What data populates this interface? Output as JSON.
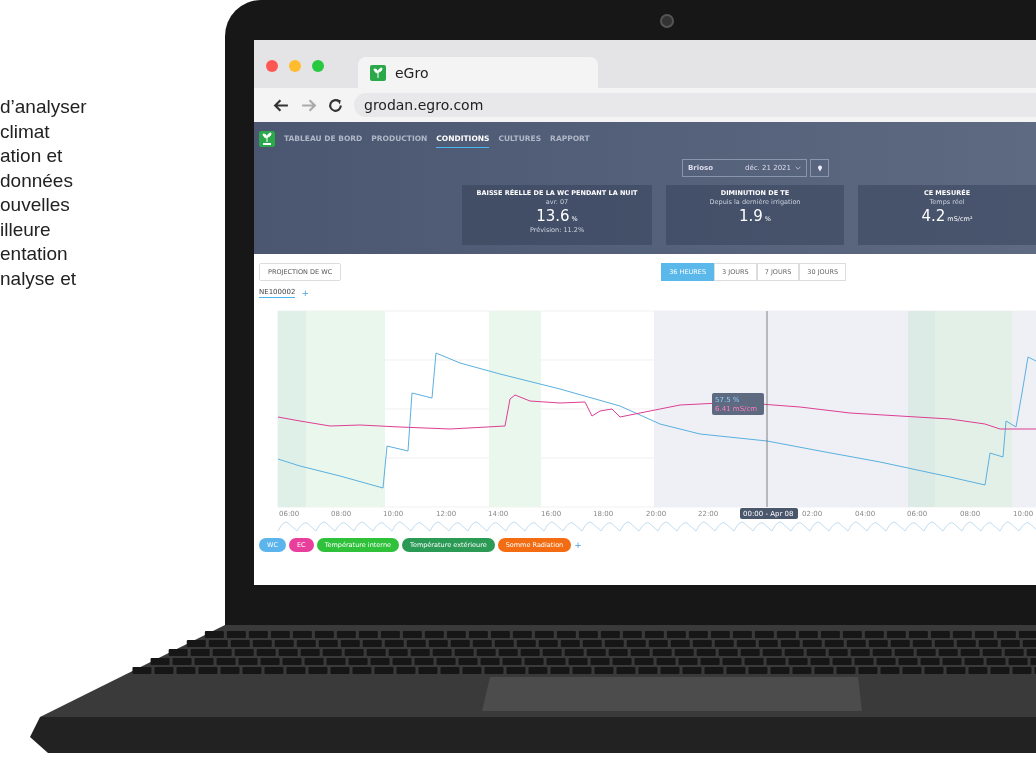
{
  "intro_lines": [
    "d’analyser",
    "climat",
    "ation et",
    "données",
    "ouvelles",
    "illeure",
    "entation",
    "nalyse et"
  ],
  "browser": {
    "tab_title": "eGro",
    "url": "grodan.egro.com"
  },
  "nav": [
    {
      "label": "TABLEAU DE BORD",
      "selected": false
    },
    {
      "label": "PRODUCTION",
      "selected": false
    },
    {
      "label": "CONDITIONS",
      "selected": true
    },
    {
      "label": "CULTURES",
      "selected": false
    },
    {
      "label": "RAPPORT",
      "selected": false
    }
  ],
  "selector": {
    "name": "Brioso",
    "date": "déc. 21 2021"
  },
  "cards": [
    {
      "title": "BAISSE RÉELLE DE LA WC PENDANT LA NUIT",
      "subtitle": "avr. 07",
      "value": "13.6",
      "unit": "%",
      "note": "Prévision: 11.2%"
    },
    {
      "title": "DIMINUTION DE TE",
      "subtitle": "Depuis la dernière irrigation",
      "value": "1.9",
      "unit": "%"
    },
    {
      "title": "CE MESURÉE",
      "subtitle": "Temps réel",
      "value": "4.2",
      "unit": "mS/cm²"
    }
  ],
  "projection_button": "PROJECTION DE WC",
  "ranges": [
    {
      "label": "36 HEURES",
      "selected": true
    },
    {
      "label": "3 JOURS",
      "selected": false
    },
    {
      "label": "7 JOURS",
      "selected": false
    },
    {
      "label": "30 JOURS",
      "selected": false
    }
  ],
  "sensor_tab": {
    "label": "NE100002",
    "add": "+"
  },
  "chart": {
    "x_labels": [
      "06:00",
      "08:00",
      "10:00",
      "12:00",
      "14:00",
      "16:00",
      "18:00",
      "20:00",
      "22:00",
      "02:00",
      "04:00",
      "06:00",
      "08:00",
      "10:00"
    ],
    "tooltip": {
      "wc": "57.5 %",
      "ec": "6.41 mS/cm"
    },
    "cursor_label": "00:00 - Apr 08"
  },
  "legend": [
    {
      "label": "WC",
      "color": "#5bb5ec"
    },
    {
      "label": "EC",
      "color": "#e83e9c"
    },
    {
      "label": "Température interne",
      "color": "#2fc13a"
    },
    {
      "label": "Température extérieure",
      "color": "#2a9a55"
    },
    {
      "label": "Somme Radiation",
      "color": "#f36c12"
    }
  ],
  "legend_add": "+"
}
